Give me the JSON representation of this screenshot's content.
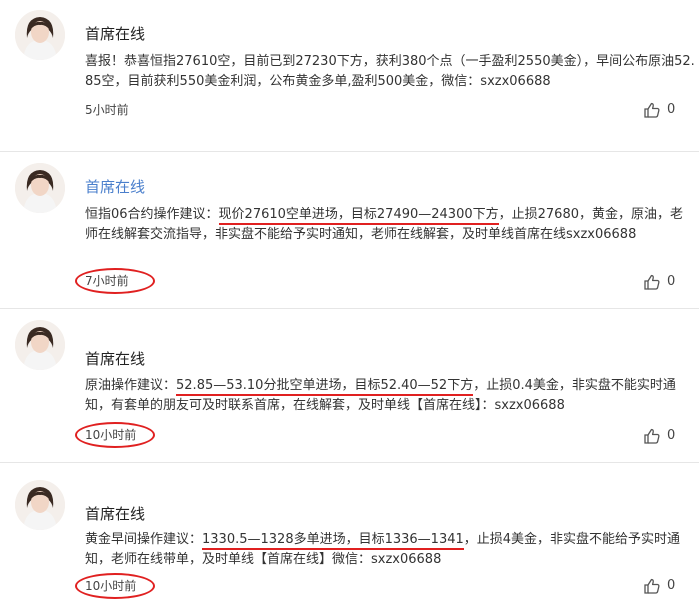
{
  "colors": {
    "author_link": "#4a7fcc",
    "annotation_red": "#e02020",
    "divider": "#e6e6e6",
    "text": "#333333"
  },
  "posts": [
    {
      "author": "首席在线",
      "text_parts": [
        "喜报！恭喜恒指27610空，目前已到27230下方，获利380个点（一手盈利2550美金），早间公布原油52.85空，目前获利550美金利润，公布黄金多单,盈利500美金，微信：sxzx06688"
      ],
      "time": "5小时前",
      "like_icon": "thumbs-up-icon",
      "likes": "0"
    },
    {
      "author": "首席在线",
      "text_parts": [
        "恒指06合约操作建议：",
        "现价27610空单进场，目标27490—24300下方",
        "，止损27680，黄金，原油，老师在线解套交流指导，非实盘不能给予实时通知，老师在线解套，及时单线首席在线sxzx06688"
      ],
      "time": "7小时前",
      "like_icon": "thumbs-up-icon",
      "likes": "0"
    },
    {
      "author": "首席在线",
      "text_parts": [
        "原油操作建议：",
        "52.85—53.10分批空单进场，目标52.40—52下方",
        "，止损0.4美金，非实盘不能实时通知，有套单的朋友可及时联系首席，在线解套，及时单线【首席在线】：sxzx06688"
      ],
      "time": "10小时前",
      "like_icon": "thumbs-up-icon",
      "likes": "0"
    },
    {
      "author": "首席在线",
      "text_parts": [
        "黄金早间操作建议：",
        "1330.5—1328多单进场，目标1336—1341",
        "，止损4美金，非实盘不能给予实时通知，老师在线带单，及时单线【首席在线】微信：sxzx06688"
      ],
      "time": "10小时前",
      "like_icon": "thumbs-up-icon",
      "likes": "0"
    }
  ]
}
